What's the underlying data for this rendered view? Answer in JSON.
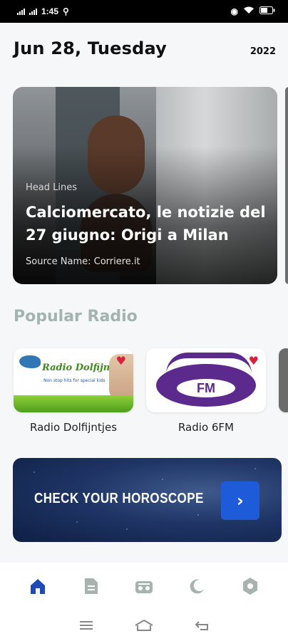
{
  "status": {
    "time": "1:45",
    "battery": "[]"
  },
  "header": {
    "date": "Jun 28, Tuesday",
    "year": "2022"
  },
  "headline": {
    "label": "Head Lines",
    "title": "Calciomercato, le notizie del 27 giugno: Origi a Milan",
    "source": "Source Name: Corriere.it"
  },
  "popular": {
    "title": "Popular Radio",
    "stations": [
      {
        "name": "Radio Dolfijntjes",
        "logo_text": "Radio Dolfijntjes",
        "tagline": "Non stop hits for special kids",
        "favorite": true
      },
      {
        "name": "Radio 6FM",
        "logo_text": "FM",
        "favorite": true
      }
    ]
  },
  "horoscope": {
    "label": "CHECK YOUR HOROSCOPE",
    "button": "›"
  },
  "nav": {
    "items": [
      "home-icon",
      "news-icon",
      "radio-icon",
      "moon-icon",
      "settings-icon"
    ],
    "active": "home-icon",
    "active_color": "#1e4bb8",
    "inactive_color": "#a8b3b0"
  }
}
